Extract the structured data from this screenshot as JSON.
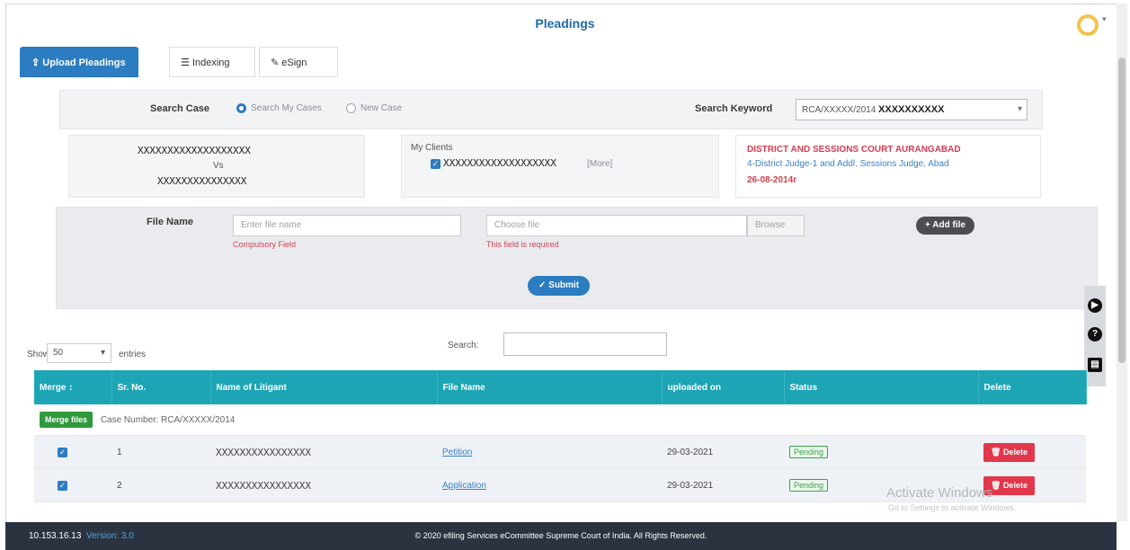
{
  "page_title": "Pleadings",
  "tabs": [
    {
      "label": "Upload Pleadings",
      "icon": "upload-icon"
    },
    {
      "label": "Indexing",
      "icon": "list-icon"
    },
    {
      "label": "eSign",
      "icon": "user-pen-icon"
    }
  ],
  "search": {
    "label": "Search Case",
    "options": [
      "Search My Cases",
      "New Case"
    ],
    "keyword_label": "Search Keyword",
    "keyword_value_prefix": "RCA/XXXXX/2014",
    "keyword_value_mask": "XXXXXXXXXX"
  },
  "case": {
    "petitioner": "XXXXXXXXXXXXXXXXXXX",
    "vs": "Vs",
    "respondent": "XXXXXXXXXXXXXXX"
  },
  "clients": {
    "label": "My Clients",
    "name": "XXXXXXXXXXXXXXXXXXX",
    "more": "[More]"
  },
  "court": {
    "title": "DISTRICT AND SESSIONS COURT AURANGABAD",
    "detail": "4-District Judge-1 and Addl. Sessions Judge, Abad",
    "date": "26-08-2014r"
  },
  "upload": {
    "file_name_label": "File Name",
    "file_name_placeholder": "Enter file name",
    "file_name_error": "Compulsory Field",
    "choose_file_placeholder": "Choose file",
    "choose_file_error": "This field is required",
    "browse_label": "Browse",
    "add_file_label": "+ Add file",
    "submit_label": "✓ Submit"
  },
  "side_tools": [
    "play-icon",
    "help-icon",
    "pdf-icon"
  ],
  "table": {
    "show_label": "Show",
    "entries_value": "50",
    "entries_label": "entries",
    "search_label": "Search:",
    "columns": [
      "Merge",
      "Sr. No.",
      "Name of Litigant",
      "File Name",
      "uploaded on",
      "Status",
      "Delete"
    ],
    "group": {
      "merge_button": "Merge files",
      "case_number": "Case Number: RCA/XXXXX/2014"
    },
    "rows": [
      {
        "sr": "1",
        "litigant": "XXXXXXXXXXXXXXXX",
        "file": "Petition",
        "uploaded": "29-03-2021",
        "status": "Pending",
        "delete": "Delete"
      },
      {
        "sr": "2",
        "litigant": "XXXXXXXXXXXXXXXX",
        "file": "Application",
        "uploaded": "29-03-2021",
        "status": "Pending",
        "delete": "Delete"
      }
    ]
  },
  "watermark": {
    "title": "Activate Windows",
    "sub": "Go to Settings to activate Windows."
  },
  "footer": {
    "ip": "10.153.16.13",
    "version": "Version: 3.0",
    "copyright": "© 2020 efiling Services eCommittee Supreme Court of India. All Rights Reserved."
  },
  "colors": {
    "primary": "#2b7cc0",
    "table_header": "#1da5b5",
    "danger": "#e2374a",
    "success": "#2f9a3c",
    "footer": "#2c3340"
  }
}
